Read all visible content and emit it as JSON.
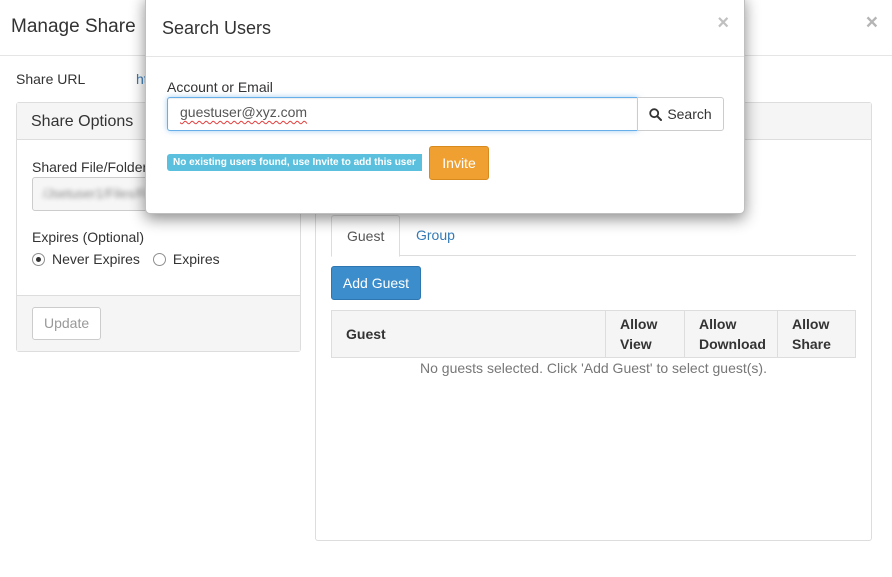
{
  "manage_share": {
    "title": "Manage Share",
    "close_glyph": "×",
    "share_url_label": "Share URL",
    "share_url_value": "ht",
    "share_options": {
      "heading": "Share Options",
      "shared_label": "Shared File/Folder",
      "shared_value": "/Jsetuser1/Files/Folder",
      "expires_label": "Expires (Optional)",
      "radio_never": "Never Expires",
      "radio_expires": "Expires",
      "selected": "Never Expires",
      "update_button": "Update"
    },
    "guests": {
      "tabs": [
        {
          "label": "Guest",
          "active": true
        },
        {
          "label": "Group",
          "active": false
        }
      ],
      "add_guest_button": "Add Guest",
      "columns": [
        "Guest",
        "Allow View",
        "Allow Download",
        "Allow Share"
      ],
      "empty_message": "No guests selected. Click 'Add Guest' to select guest(s)."
    }
  },
  "search_users": {
    "title": "Search Users",
    "close_glyph": "×",
    "field_label": "Account or Email",
    "field_value": "guestuser@xyz.com",
    "search_button": "Search",
    "search_icon": "search-icon",
    "status_badge": "No existing users found, use Invite to add this user",
    "invite_button": "Invite"
  },
  "colors": {
    "primary": "#3c8dcc",
    "info_badge": "#5bc0de",
    "warning": "#f0a030",
    "link": "#337ab7"
  }
}
